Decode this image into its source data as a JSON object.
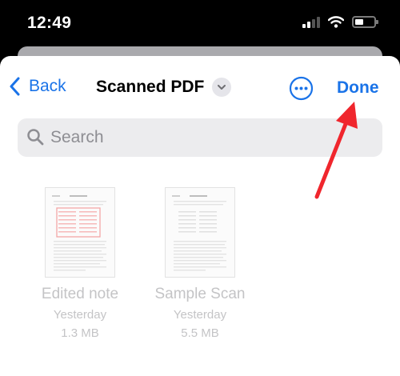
{
  "status_bar": {
    "time": "12:49"
  },
  "nav": {
    "back_label": "Back",
    "title": "Scanned PDF",
    "done_label": "Done"
  },
  "search": {
    "placeholder": "Search",
    "value": ""
  },
  "files": [
    {
      "name": "Edited note",
      "date": "Yesterday",
      "size": "1.3 MB"
    },
    {
      "name": "Sample Scan",
      "date": "Yesterday",
      "size": "5.5 MB"
    }
  ],
  "colors": {
    "accent": "#1a73e8",
    "annotation_arrow": "#f0262d"
  },
  "icons": [
    "signal-icon",
    "wifi-icon",
    "battery-icon",
    "chevron-left-icon",
    "chevron-down-icon",
    "more-icon",
    "search-icon"
  ]
}
